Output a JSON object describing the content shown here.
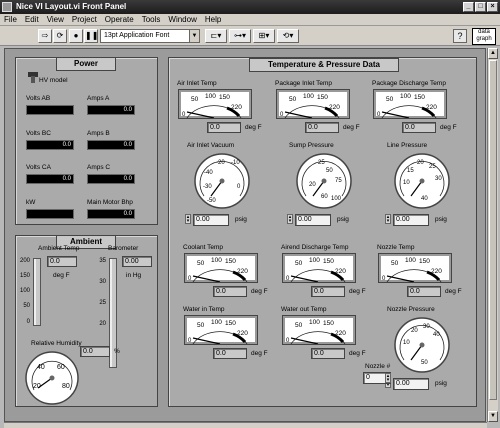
{
  "window": {
    "title": "Nice VI Layout.vi Front Panel",
    "controls": [
      "_",
      "□",
      "×"
    ]
  },
  "menu": [
    "File",
    "Edit",
    "View",
    "Project",
    "Operate",
    "Tools",
    "Window",
    "Help"
  ],
  "toolbar": {
    "font": "13pt Application Font",
    "vi_icon_text": "data graph"
  },
  "power": {
    "title": "Power",
    "hv_model": "HV model",
    "fields": [
      {
        "label": "Volts AB",
        "value": ""
      },
      {
        "label": "Amps A",
        "value": "0.0"
      },
      {
        "label": "Volts BC",
        "value": "0.0"
      },
      {
        "label": "Amps B",
        "value": "0.0"
      },
      {
        "label": "Volts CA",
        "value": "0.0"
      },
      {
        "label": "Amps C",
        "value": "0.0"
      },
      {
        "label": "kW",
        "value": ""
      },
      {
        "label": "Main Motor Bhp",
        "value": "0.0"
      }
    ]
  },
  "ambient": {
    "title": "Ambient",
    "temp_label": "Ambient Temp",
    "temp_value": "0.0",
    "temp_unit": "deg F",
    "temp_scale": [
      "200",
      "150",
      "100",
      "50",
      "0"
    ],
    "baro_label": "Barometer",
    "baro_value": "0.00",
    "baro_unit": "in Hg",
    "baro_scale": [
      "35",
      "30",
      "25",
      "20"
    ],
    "humidity_label": "Relative Humidity",
    "humidity_value": "0.0",
    "humidity_unit": "%",
    "humidity_scale": [
      "20",
      "40",
      "60",
      "80"
    ]
  },
  "tp": {
    "title": "Temperature & Pressure Data",
    "meter_scale": [
      "50",
      "100",
      "150",
      "220"
    ],
    "meter_zero": "0",
    "meters": [
      {
        "label": "Air Inlet Temp",
        "value": "0.0",
        "unit": "deg F"
      },
      {
        "label": "Package Inlet Temp",
        "value": "0.0",
        "unit": "deg F"
      },
      {
        "label": "Package Discharge Temp",
        "value": "0.0",
        "unit": "deg F"
      },
      {
        "label": "Coolant Temp",
        "value": "0.0",
        "unit": "deg F"
      },
      {
        "label": "Airend Discharge Temp",
        "value": "0.0",
        "unit": "deg F"
      },
      {
        "label": "Nozzle Temp",
        "value": "0.0",
        "unit": "deg F"
      },
      {
        "label": "Water in Temp",
        "value": "0.0",
        "unit": "deg F"
      },
      {
        "label": "Water out Temp",
        "value": "0.0",
        "unit": "deg F"
      }
    ],
    "gauges": [
      {
        "label": "Air Inlet Vacuum",
        "value": "0.00",
        "unit": "psig",
        "scale": [
          "-40",
          "-30",
          "-20",
          "-10",
          "-50",
          "0"
        ]
      },
      {
        "label": "Sump Pressure",
        "value": "0.00",
        "unit": "psig",
        "scale": [
          "25",
          "50",
          "75",
          "100",
          "20",
          "60"
        ]
      },
      {
        "label": "Line Pressure",
        "value": "0.00",
        "unit": "psig",
        "scale": [
          "20",
          "25",
          "15",
          "30",
          "10",
          "40"
        ]
      },
      {
        "label": "Nozzle Pressure",
        "value": "0.00",
        "unit": "psig",
        "scale": [
          "20",
          "30",
          "40",
          "10",
          "50"
        ]
      }
    ],
    "nozzle_num_label": "Nozzle #",
    "nozzle_num_value": "0"
  }
}
